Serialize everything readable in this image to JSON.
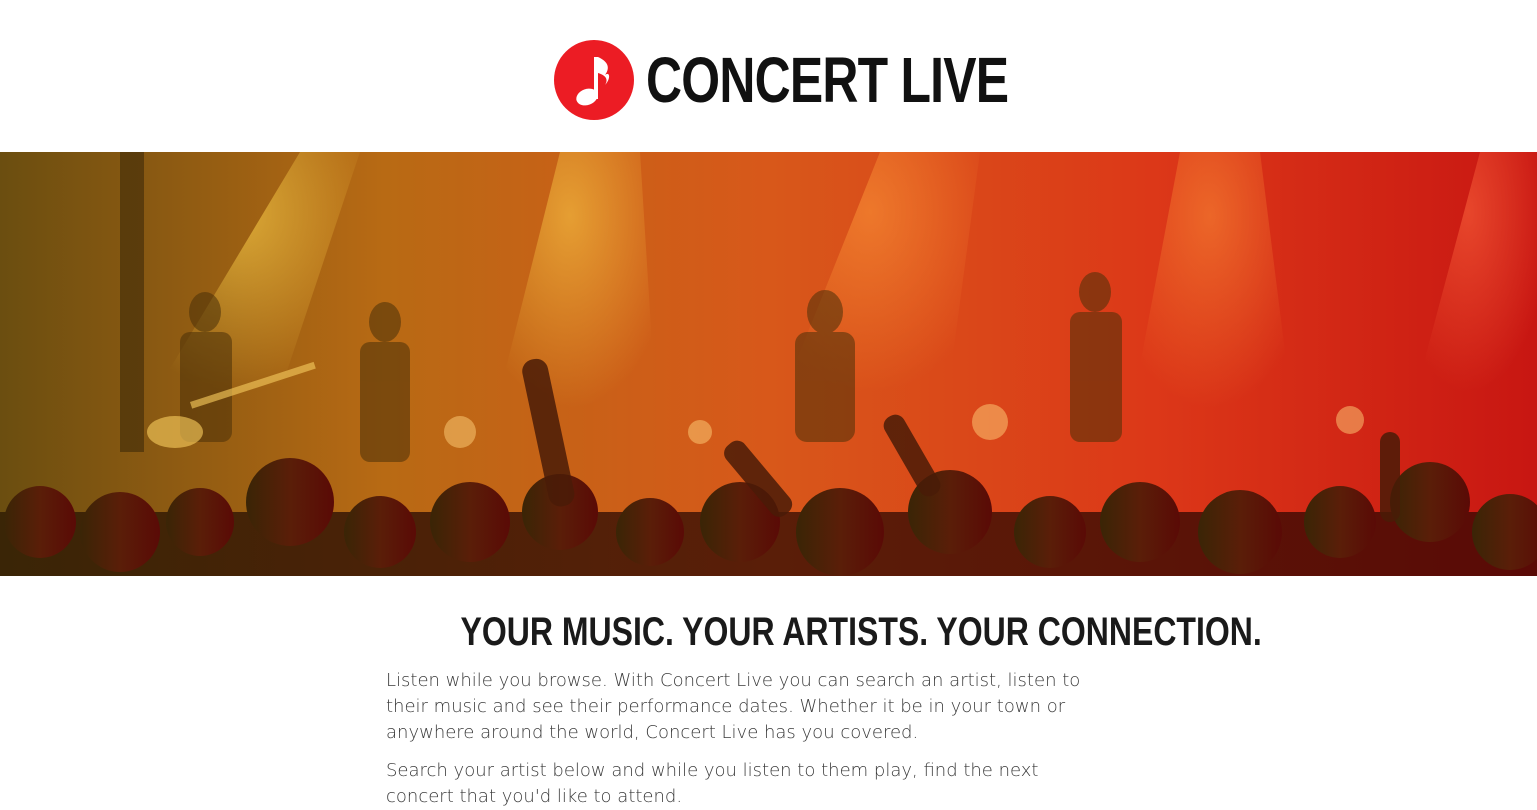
{
  "brand": {
    "name": "CONCERT LIVE",
    "logo_icon": "music-note-icon",
    "accent_color": "#ec1c24"
  },
  "hero": {
    "image_subject": "concert-crowd-photo",
    "overlay_colors": [
      "#c8a016",
      "#e8701a",
      "#e02a1a"
    ]
  },
  "main": {
    "headline": "YOUR MUSIC. YOUR ARTISTS. YOUR CONNECTION.",
    "paragraph_1": "Listen while you browse. With Concert Live you can search an artist, listen to their music and see their performance dates. Whether it be in your town or anywhere around the world, Concert Live has you covered.",
    "paragraph_2": "Search your artist below and while you listen to them play, find the next concert that you'd like to attend."
  }
}
